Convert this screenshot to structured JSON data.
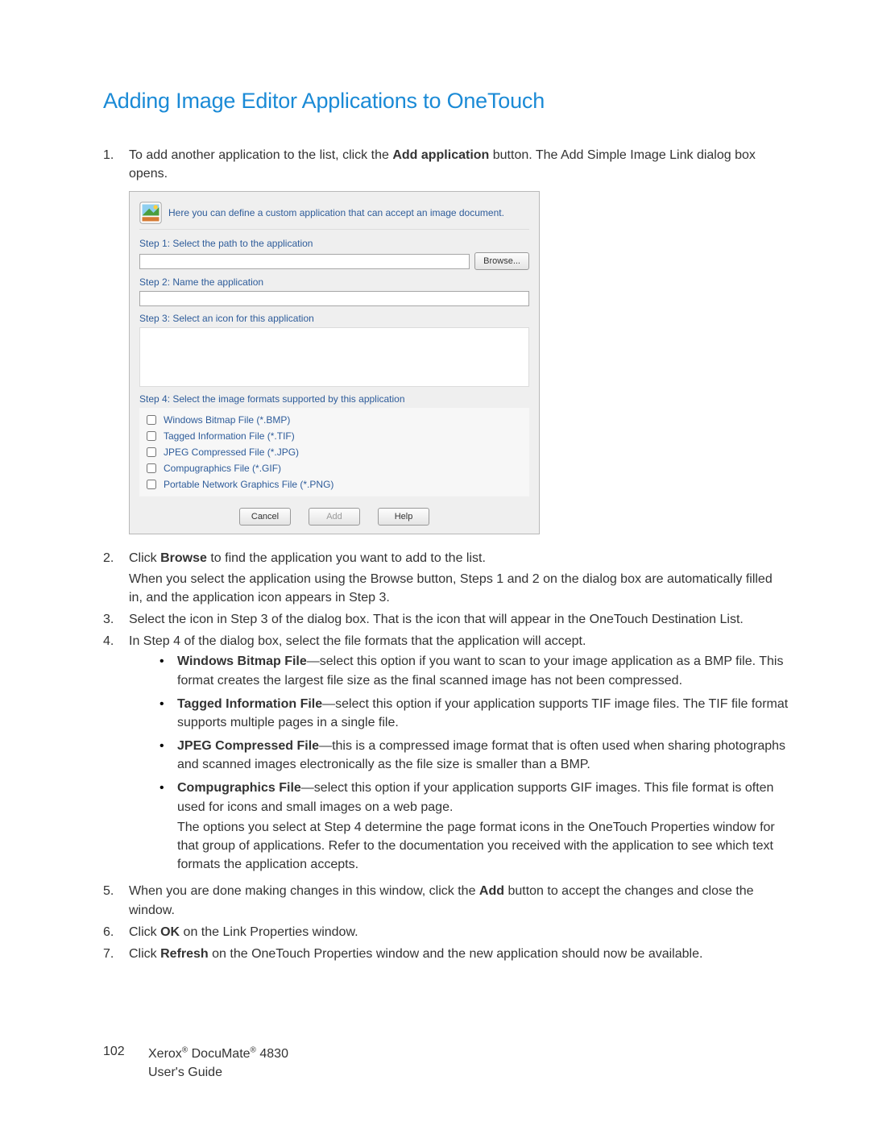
{
  "heading": "Adding Image Editor Applications to OneTouch",
  "step1": {
    "num": "1.",
    "pre": "To add another application to the list, click the ",
    "bold": "Add application",
    "post": " button. The Add Simple Image Link dialog box opens."
  },
  "dialog": {
    "header": "Here you can define a custom application that can accept an image document.",
    "s1": "Step 1: Select the path to the application",
    "browse": "Browse...",
    "s2": "Step 2: Name the application",
    "s3": "Step 3: Select an icon for this application",
    "s4": "Step 4: Select the image formats supported by this application",
    "fmt_bmp": "Windows Bitmap File (*.BMP)",
    "fmt_tif": "Tagged Information File (*.TIF)",
    "fmt_jpg": "JPEG Compressed File (*.JPG)",
    "fmt_gif": "Compugraphics File (*.GIF)",
    "fmt_png": "Portable Network Graphics File (*.PNG)",
    "btn_cancel": "Cancel",
    "btn_add": "Add",
    "btn_help": "Help"
  },
  "step2": {
    "num": "2.",
    "l1a": "Click ",
    "l1b": "Browse",
    "l1c": " to find the application you want to add to the list.",
    "l2": "When you select the application using the Browse button, Steps 1 and 2 on the dialog box are automatically filled in, and the application icon appears in Step 3."
  },
  "step3": {
    "num": "3.",
    "txt": "Select the icon in Step 3 of the dialog box. That is the icon that will appear in the OneTouch Destination List."
  },
  "step4": {
    "num": "4.",
    "txt": "In Step 4 of the dialog box, select the file formats that the application will accept.",
    "b1_bold": "Windows Bitmap File",
    "b1_txt": "—select this option if you want to scan to your image application as a BMP file. This format creates the largest file size as the final scanned image has not been compressed.",
    "b2_bold": "Tagged Information File",
    "b2_txt": "—select this option if your application supports TIF image files. The TIF file format supports multiple pages in a single file.",
    "b3_bold": "JPEG Compressed File",
    "b3_txt": "—this is a compressed image format that is often used when sharing photographs and scanned images electronically as the file size is smaller than a BMP.",
    "b4_bold": "Compugraphics File",
    "b4_txt": "—select this option if your application supports GIF images. This file format is often used for icons and small images on a web page.",
    "para": "The options you select at Step 4 determine the page format icons in the OneTouch Properties window for that group of applications. Refer to the documentation you received with the application to see which text formats the application accepts."
  },
  "step5": {
    "num": "5.",
    "a": "When you are done making changes in this window, click the ",
    "b": "Add",
    "c": " button to accept the changes and close the window."
  },
  "step6": {
    "num": "6.",
    "a": "Click ",
    "b": "OK",
    "c": " on the Link Properties window."
  },
  "step7": {
    "num": "7.",
    "a": "Click ",
    "b": "Refresh",
    "c": " on the OneTouch Properties window and the new application should now be available."
  },
  "footer": {
    "page": "102",
    "line1a": "Xerox",
    "line1b": " DocuMate",
    "line1c": " 4830",
    "line2": "User's Guide",
    "reg": "®"
  }
}
